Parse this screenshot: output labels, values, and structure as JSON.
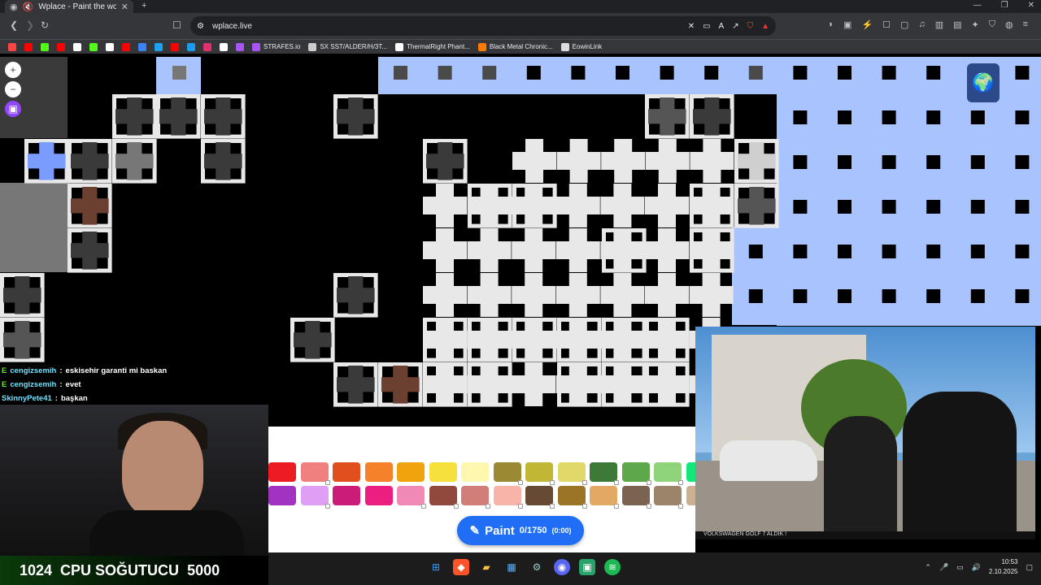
{
  "browser": {
    "tab_title": "Wplace - Paint the world",
    "new_tab_icon": "plus-icon",
    "url": "wplace.live",
    "window_controls": [
      "—",
      "❐",
      "✕"
    ]
  },
  "bookmarks": [
    {
      "label": "",
      "color": "#ff4444"
    },
    {
      "label": "",
      "color": "#ff0000"
    },
    {
      "label": "",
      "color": "#53fc18"
    },
    {
      "label": "",
      "color": "#ff0000"
    },
    {
      "label": "",
      "color": "#ffffff"
    },
    {
      "label": "",
      "color": "#53fc18"
    },
    {
      "label": "",
      "color": "#ffffff"
    },
    {
      "label": "",
      "color": "#ff0000"
    },
    {
      "label": "",
      "color": "#3b82f6"
    },
    {
      "label": "",
      "color": "#1da1f2"
    },
    {
      "label": "",
      "color": "#ff0000"
    },
    {
      "label": "",
      "color": "#1d9bf0"
    },
    {
      "label": "",
      "color": "#e1306c"
    },
    {
      "label": "",
      "color": "#ffffff"
    },
    {
      "label": "",
      "color": "#a855f7"
    },
    {
      "label": "STRAFES.io",
      "color": "#a855f7"
    },
    {
      "label": "SX SST/ALDER/H/3T...",
      "color": "#cccccc"
    },
    {
      "label": "ThermalRight Phant...",
      "color": "#ffffff"
    },
    {
      "label": "Black Metal Chronic...",
      "color": "#ff7a00"
    },
    {
      "label": "EowinLink",
      "color": "#dddddd"
    }
  ],
  "chat": [
    {
      "badge": "E",
      "user": "cengizsemih",
      "message": "eskisehir garanti mi baskan"
    },
    {
      "badge": "E",
      "user": "cengizsemih",
      "message": "evet"
    },
    {
      "badge": "",
      "user": "SkinnyPete41",
      "message": "başkan"
    }
  ],
  "stream_stats": {
    "left_value": "1024",
    "label": "CPU SOĞUTUCU",
    "right_value": "5000"
  },
  "video": {
    "caption": "VOLKSWAGEN GOLF 7 ALDIK !"
  },
  "palette": {
    "row1": [
      "#ed1c24",
      "#f08080",
      "#e04f1d",
      "#f5812a",
      "#f0a30c",
      "#f5e03c",
      "#fdf7b0",
      "#9b8a33",
      "#c2b635",
      "#e0d96a",
      "#3d7a38",
      "#5ea84b",
      "#8fd37a",
      "#13e67b"
    ],
    "row2": [
      "#a232c2",
      "#e09ff5",
      "#cc1c7a",
      "#ec1f80",
      "#f08ab5",
      "#91493e",
      "#d17d7a",
      "#f8b4a9",
      "#674a33",
      "#9c7428",
      "#e3a864",
      "#7b6352",
      "#9c846b",
      "#cab193"
    ],
    "locked_row1": [
      false,
      true,
      false,
      false,
      false,
      false,
      false,
      true,
      true,
      true,
      true,
      true,
      true,
      true
    ],
    "locked_row2": [
      false,
      true,
      false,
      false,
      true,
      true,
      true,
      true,
      true,
      true,
      true,
      true,
      true,
      true
    ]
  },
  "paint_button": {
    "label": "Paint",
    "count": "0/1750",
    "timer": "(0:00)"
  },
  "canvas": {
    "zoom_in": "+",
    "zoom_out": "−"
  },
  "taskbar": {
    "time": "10:53",
    "date": "2.10.2025"
  }
}
